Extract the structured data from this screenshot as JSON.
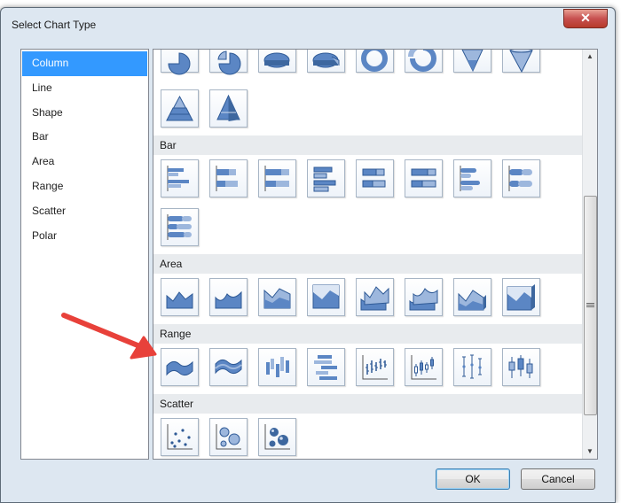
{
  "window": {
    "title": "Select Chart Type",
    "close_glyph": "✕"
  },
  "categories": [
    {
      "label": "Column",
      "selected": true
    },
    {
      "label": "Line",
      "selected": false
    },
    {
      "label": "Shape",
      "selected": false
    },
    {
      "label": "Bar",
      "selected": false
    },
    {
      "label": "Area",
      "selected": false
    },
    {
      "label": "Range",
      "selected": false
    },
    {
      "label": "Scatter",
      "selected": false
    },
    {
      "label": "Polar",
      "selected": false
    }
  ],
  "gallery": {
    "sections": [
      {
        "label": "Bar"
      },
      {
        "label": "Area"
      },
      {
        "label": "Range"
      },
      {
        "label": "Scatter"
      }
    ],
    "shape_icons": [
      "pie-chart-icon",
      "exploded-pie-chart-icon",
      "3d-pie-chart-icon",
      "3d-exploded-pie-chart-icon",
      "doughnut-chart-icon",
      "exploded-doughnut-chart-icon",
      "funnel-chart-icon",
      "3d-funnel-chart-icon",
      "pyramid-chart-icon",
      "3d-pyramid-chart-icon"
    ],
    "bar_icons": [
      "clustered-bar-icon",
      "stacked-bar-icon",
      "100-stacked-bar-icon",
      "3d-clustered-bar-icon",
      "3d-stacked-bar-icon",
      "3d-100-stacked-bar-icon",
      "clustered-cylinder-bar-icon",
      "stacked-cylinder-bar-icon",
      "100-stacked-cylinder-bar-icon"
    ],
    "area_icons": [
      "area-chart-icon",
      "smooth-area-chart-icon",
      "stacked-area-chart-icon",
      "100-stacked-area-chart-icon",
      "3d-area-chart-icon",
      "3d-smooth-area-chart-icon",
      "3d-stacked-area-chart-icon",
      "3d-100-stacked-area-chart-icon"
    ],
    "range_icons": [
      "range-area-chart-icon",
      "smooth-range-area-chart-icon",
      "range-column-chart-icon",
      "range-bar-chart-icon",
      "stock-chart-icon",
      "candlestick-chart-icon",
      "error-bar-chart-icon",
      "box-plot-chart-icon"
    ],
    "scatter_icons": [
      "scatter-chart-icon",
      "bubble-chart-icon",
      "3d-bubble-chart-icon"
    ]
  },
  "buttons": {
    "ok": "OK",
    "cancel": "Cancel"
  },
  "colors": {
    "selection": "#3399ff",
    "icon_blue": "#4e79b8",
    "annotation_arrow": "#e8413a"
  }
}
